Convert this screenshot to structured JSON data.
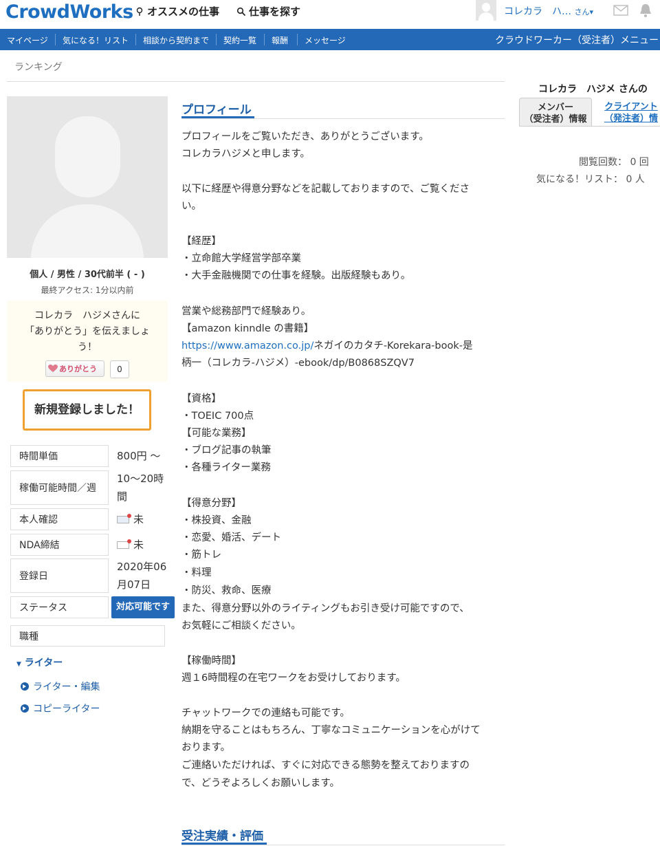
{
  "header": {
    "logo": "CrowdWorks",
    "nav_recommended": "オススメの仕事",
    "nav_search": "仕事を探す",
    "user_name": "コレカラ　ハ…",
    "user_suffix": "さん▾"
  },
  "menubar": {
    "items": [
      "マイページ",
      "気になる！リスト",
      "相談から契約まで",
      "契約一覧",
      "報酬",
      "メッセージ"
    ],
    "right": "クラウドワーカー（受注者）メニュー"
  },
  "breadcrumb": "ランキング",
  "profile_side": {
    "info": "個人 / 男性 / 30代前半 ( - )",
    "last_access": "最終アクセス: 1分以内前",
    "thanks_text": "コレカラ　ハジメさんに「ありがとう」を伝えましょう！",
    "thanks_line1": "コレカラ　ハジメさんに",
    "thanks_line2": "「ありがとう」を伝えましょ",
    "thanks_line3": "う！",
    "thanks_button": "ありがとう",
    "thanks_count": "0",
    "registered_banner": "新規登録しました！",
    "rows": [
      {
        "label": "時間単価",
        "value": "800円 ～"
      },
      {
        "label": "稼働可能時間／週",
        "value1": "10〜20時",
        "value2": "間"
      },
      {
        "label": "本人確認",
        "value": "未"
      },
      {
        "label": "NDA締結",
        "value": "未"
      },
      {
        "label": "登録日",
        "value1": "2020年06",
        "value2": "月07日"
      },
      {
        "label": "ステータス",
        "value": "対応可能です"
      }
    ],
    "job_type_label": "職種",
    "category": "ライター",
    "subcategories": [
      "ライター・編集",
      "コピーライター"
    ]
  },
  "profile": {
    "title": "プロフィール",
    "lines": [
      "プロフィールをご覧いただき、ありがとうございます。",
      "コレカラハジメと申します。",
      "以下に経歴や得意分野などを記載しておりますので、ご覧くださ",
      "い。",
      "【経歴】",
      "・立命館大学経営学部卒業",
      "・大手金融機関での仕事を経験。出版経験もあり。",
      "営業や総務部門で経験あり。",
      "【amazon kinndle の書籍】",
      "柄一（コレカラ-ハジメ）-ebook/dp/B0868SZQV7",
      "【資格】",
      "・TOEIC 700点",
      "【可能な業務】",
      "・ブログ記事の執筆",
      "・各種ライター業務",
      "【得意分野】",
      "・株投資、金融",
      "・恋愛、婚活、デート",
      "・筋トレ",
      "・料理",
      "・防災、救命、医療",
      "また、得意分野以外のライティングもお引き受け可能ですので、",
      "お気軽にご相談ください。",
      "【稼働時間】",
      "週１6時間程の在宅ワークをお受けしております。",
      "チャットワークでの連絡も可能です。",
      "納期を守ることはもちろん、丁寧なコミュニケーションを心がけて",
      "おります。",
      "ご連絡いただければ、すぐに対応できる態勢を整えておりますの",
      "で、どうぞよろしくお願いします。"
    ],
    "amazon_link": "https://www.amazon.co.jp/",
    "amazon_link_rest": "ネガイのカタチ-Korekara-book-是"
  },
  "orders_title": "受注実績・評価",
  "right_panel": {
    "title": "コレカラ　ハジメ さんの",
    "tab_member_1": "メンバー",
    "tab_member_2": "（受注者）情報",
    "tab_client_1": "クライアント",
    "tab_client_2": "（発注者）情",
    "views_label": "閲覧回数：",
    "views_value": "0 回",
    "fav_label": "気になる！リスト：",
    "fav_value": "0 人"
  }
}
